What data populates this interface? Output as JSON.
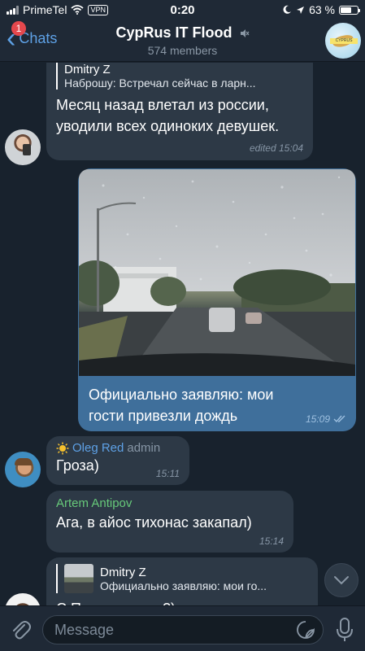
{
  "status": {
    "carrier": "PrimeTel",
    "vpn": "VPN",
    "time": "0:20",
    "battery_text": "63 %",
    "battery_level": 0.63
  },
  "header": {
    "back_label": "Chats",
    "unread_badge": "1",
    "title": "CypRus IT Flood",
    "subtitle": "574 members",
    "group_avatar_text": "CYPRUS"
  },
  "messages": [
    {
      "reply_name": "Dmitry Z",
      "reply_text": "Наброшу: Встречал сейчас в ларн...",
      "text": "Месяц назад влетал из россии, уводили всех одиноких девушек.",
      "time": "edited 15:04"
    },
    {
      "text": "Официально заявляю: мои гости привезли дождь",
      "time": "15:09",
      "status": "read"
    },
    {
      "sender": "Oleg Red",
      "role": "admin",
      "text": "Гроза)",
      "time": "15:11"
    },
    {
      "sender": "Artem Antipov",
      "text": "Ага, в айос тихонас закапал)",
      "time": "15:14"
    },
    {
      "reply_name": "Dmitry Z",
      "reply_text": "Официально заявляю: мои го...",
      "text": "С Питера чтоль?)"
    }
  ],
  "input": {
    "placeholder": "Message"
  },
  "colors": {
    "background": "#18222d",
    "incoming": "#2d3946",
    "outgoing": "#3f6f9b",
    "accent": "#5ea1e6",
    "sender_green": "#67c97a"
  },
  "icons": [
    "back-chevron-icon",
    "mute-icon",
    "sun-emoji-icon",
    "double-check-icon",
    "chevron-down-icon",
    "paperclip-icon",
    "sticker-icon",
    "microphone-icon"
  ]
}
